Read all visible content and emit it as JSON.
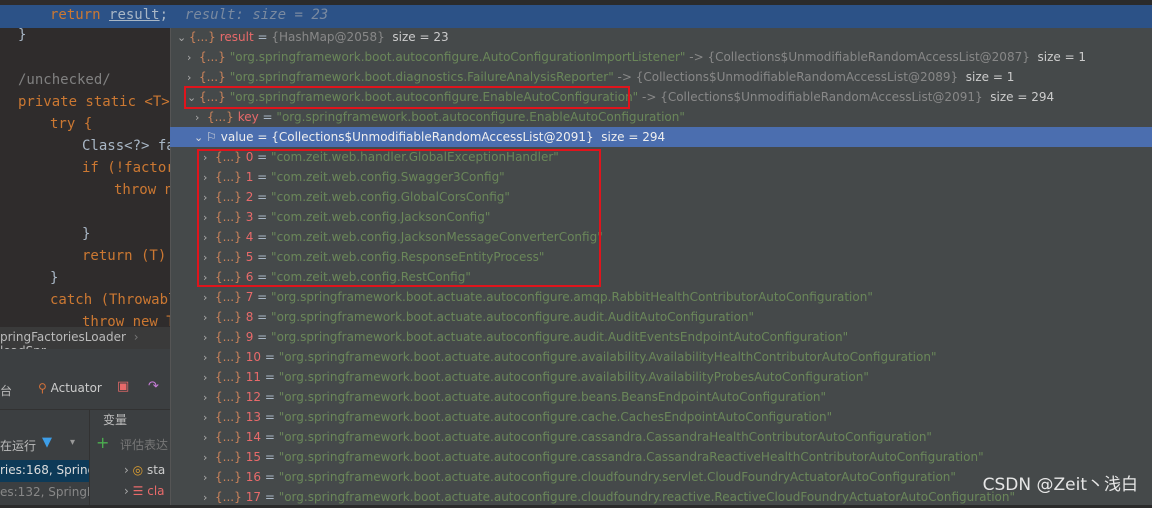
{
  "editor": {
    "current_line": {
      "code": "return result;",
      "hint": "result:  size = 23"
    },
    "lines": [
      "}",
      "/unchecked/",
      "private static <T>",
      "try {",
      "Class<?> fa",
      "if (!factor",
      "throw n",
      "}",
      "return (T)",
      "}",
      "catch (Throwabl",
      "throw new T"
    ],
    "breadcrumb": [
      "pringFactoriesLoader",
      "loadSpr"
    ]
  },
  "toolwindow": {
    "tab_partial": "台",
    "actuator_label": "Actuator",
    "variables_header": "变量",
    "running_label": "在运行",
    "eval_placeholder": "评估表达",
    "frames": [
      "ries:168, Spring",
      "es:132, SpringF"
    ],
    "vars": [
      "sta",
      "cla"
    ]
  },
  "popup": {
    "root": {
      "name": "result",
      "value": "{HashMap@2058}",
      "size": "size = 23"
    },
    "entries": [
      {
        "key": "\"org.springframework.boot.autoconfigure.AutoConfigurationImportListener\"",
        "value": "{Collections$UnmodifiableRandomAccessList@2087}",
        "size": "size = 1",
        "expanded": false
      },
      {
        "key": "\"org.springframework.boot.diagnostics.FailureAnalysisReporter\"",
        "value": "{Collections$UnmodifiableRandomAccessList@2089}",
        "size": "size = 1",
        "expanded": false
      },
      {
        "key": "\"org.springframework.boot.autoconfigure.EnableAutoConfiguration\"",
        "value": "{Collections$UnmodifiableRandomAccessList@2091}",
        "size": "size = 294",
        "expanded": true
      }
    ],
    "key_row": {
      "name": "key",
      "value": "\"org.springframework.boot.autoconfigure.EnableAutoConfiguration\""
    },
    "value_row": {
      "name": "value",
      "value": "{Collections$UnmodifiableRandomAccessList@2091}",
      "size": "size = 294"
    },
    "items": [
      "\"com.zeit.web.handler.GlobalExceptionHandler\"",
      "\"com.zeit.web.config.Swagger3Config\"",
      "\"com.zeit.web.config.GlobalCorsConfig\"",
      "\"com.zeit.web.config.JacksonConfig\"",
      "\"com.zeit.web.config.JacksonMessageConverterConfig\"",
      "\"com.zeit.web.config.ResponseEntityProcess\"",
      "\"com.zeit.web.config.RestConfig\"",
      "\"org.springframework.boot.actuate.autoconfigure.amqp.RabbitHealthContributorAutoConfiguration\"",
      "\"org.springframework.boot.actuate.autoconfigure.audit.AuditAutoConfiguration\"",
      "\"org.springframework.boot.actuate.autoconfigure.audit.AuditEventsEndpointAutoConfiguration\"",
      "\"org.springframework.boot.actuate.autoconfigure.availability.AvailabilityHealthContributorAutoConfiguration\"",
      "\"org.springframework.boot.actuate.autoconfigure.availability.AvailabilityProbesAutoConfiguration\"",
      "\"org.springframework.boot.actuate.autoconfigure.beans.BeansEndpointAutoConfiguration\"",
      "\"org.springframework.boot.actuate.autoconfigure.cache.CachesEndpointAutoConfiguration\"",
      "\"org.springframework.boot.actuate.autoconfigure.cassandra.CassandraHealthContributorAutoConfiguration\"",
      "\"org.springframework.boot.actuate.autoconfigure.cassandra.CassandraReactiveHealthContributorAutoConfiguration\"",
      "\"org.springframework.boot.actuate.autoconfigure.cloudfoundry.servlet.CloudFoundryActuatorAutoConfiguration\"",
      "\"org.springframework.boot.actuate.autoconfigure.cloudfoundry.reactive.ReactiveCloudFoundryActuatorAutoConfiguration\""
    ]
  },
  "watermark": "CSDN @Zeit丶浅白",
  "colors": {
    "highlight": "#e0141c",
    "selection": "#4b6eaf",
    "string": "#6a8759",
    "name": "#e86a6a"
  }
}
